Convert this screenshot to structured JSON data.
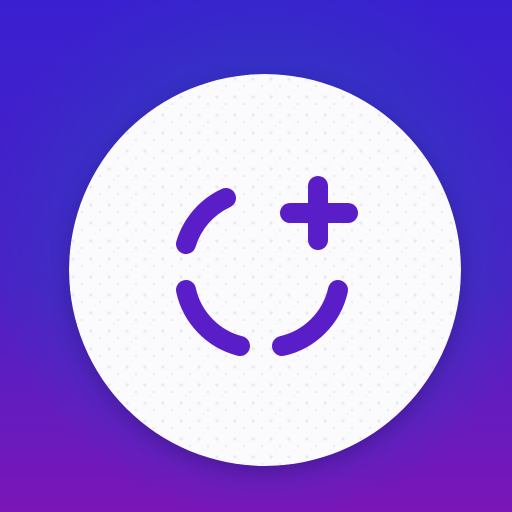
{
  "app_icon": {
    "icon": "add-status-icon",
    "colors": {
      "background_top": "#3a1fd0",
      "background_mid": "#4a22c6",
      "background_bottom": "#7a16b8",
      "glow": "#2e3fbf",
      "badge": "#fbfbfd",
      "glyph": "#5a1ec8"
    }
  }
}
